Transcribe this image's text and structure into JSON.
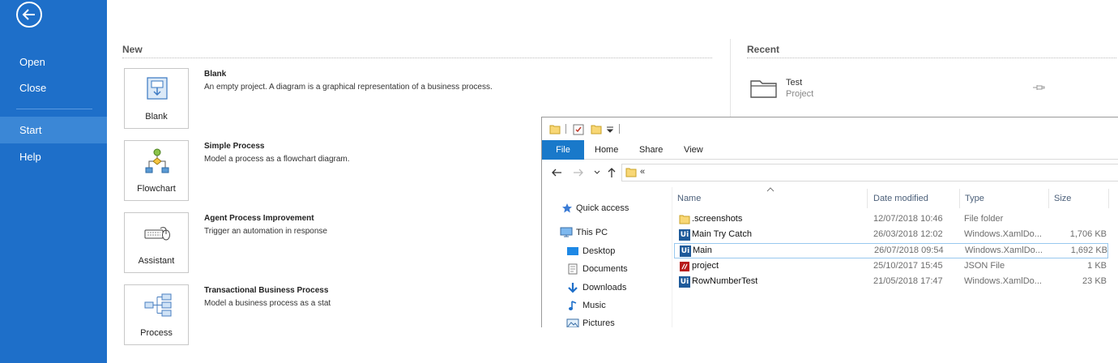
{
  "sidebar": {
    "items": [
      {
        "label": "Open"
      },
      {
        "label": "Close"
      },
      {
        "label": "Start",
        "active": true
      },
      {
        "label": "Help"
      }
    ]
  },
  "new_section": {
    "title": "New",
    "templates": [
      {
        "tile_label": "Blank",
        "title": "Blank",
        "description": "An empty project. A diagram is a graphical representation of a business process.",
        "icon": "blank-diagram-icon"
      },
      {
        "tile_label": "Flowchart",
        "title": "Simple Process",
        "description": "Model a process as a flowchart diagram.",
        "icon": "flowchart-icon"
      },
      {
        "tile_label": "Assistant",
        "title": "Agent Process Improvement",
        "description": "Trigger an automation in response",
        "icon": "assistant-icon"
      },
      {
        "tile_label": "Process",
        "title": "Transactional Business Process",
        "description": "Model a business process as a stat",
        "icon": "process-icon"
      }
    ]
  },
  "recent_section": {
    "title": "Recent",
    "items": [
      {
        "name": "Test",
        "type": "Project",
        "icon": "folder-icon"
      }
    ]
  },
  "explorer": {
    "ribbon_tabs": [
      "File",
      "Home",
      "Share",
      "View"
    ],
    "address": "«",
    "nav": {
      "quick_access": "Quick access",
      "this_pc": "This PC",
      "items": [
        "Desktop",
        "Documents",
        "Downloads",
        "Music",
        "Pictures"
      ]
    },
    "columns": {
      "name": "Name",
      "date": "Date modified",
      "type": "Type",
      "size": "Size"
    },
    "files": [
      {
        "name": ".screenshots",
        "date": "12/07/2018 10:46",
        "type": "File folder",
        "size": "",
        "icon": "folder-icon"
      },
      {
        "name": "Main Try Catch",
        "date": "26/03/2018 12:02",
        "type": "Windows.XamlDo...",
        "size": "1,706 KB",
        "icon": "uipath-file-icon"
      },
      {
        "name": "Main",
        "date": "26/07/2018 09:54",
        "type": "Windows.XamlDo...",
        "size": "1,692 KB",
        "icon": "uipath-file-icon",
        "selected": true
      },
      {
        "name": "project",
        "date": "25/10/2017 15:45",
        "type": "JSON File",
        "size": "1 KB",
        "icon": "json-file-icon"
      },
      {
        "name": "RowNumberTest",
        "date": "21/05/2018 17:47",
        "type": "Windows.XamlDo...",
        "size": "23 KB",
        "icon": "uipath-file-icon"
      }
    ]
  },
  "colors": {
    "sidebar": "#1e6fc9",
    "sidebar_active": "#3b87d6",
    "file_tab": "#1979ca",
    "uipath_icon": "#1e5a9a"
  }
}
